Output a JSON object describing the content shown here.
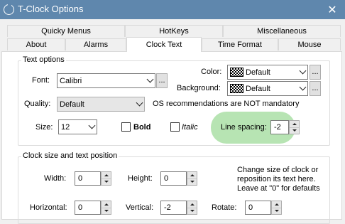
{
  "window": {
    "title": "T-Clock Options",
    "close_glyph": "✕",
    "accent": "#5f87ad"
  },
  "tabs_row1": [
    "Quicky Menus",
    "HotKeys",
    "Miscellaneous"
  ],
  "tabs_row2": [
    "About",
    "Alarms",
    "Clock Text",
    "Time Format",
    "Mouse"
  ],
  "selected_tab": "Clock Text",
  "text_options": {
    "group_label": "Text options",
    "font_label": "Font:",
    "font_value": "Calibri",
    "color_label": "Color:",
    "color_value": "Default",
    "background_label": "Background:",
    "background_value": "Default",
    "quality_label": "Quality:",
    "quality_value": "Default",
    "os_note": "OS recommendations are NOT mandatory",
    "size_label": "Size:",
    "size_value": "12",
    "bold_label": "Bold",
    "italic_label": "Italic",
    "line_spacing_label": "Line spacing:",
    "line_spacing_value": "-2",
    "ellipsis": "...",
    "highlight_color": "#b7e4b3"
  },
  "clock_size": {
    "group_label": "Clock size and text position",
    "width_label": "Width:",
    "width_value": "0",
    "height_label": "Height:",
    "height_value": "0",
    "help_line1": "Change size of clock or",
    "help_line2": "reposition its text here.",
    "help_line3": "Leave at \"0\" for defaults",
    "horizontal_label": "Horizontal:",
    "horizontal_value": "0",
    "vertical_label": "Vertical:",
    "vertical_value": "-2",
    "rotate_label": "Rotate:",
    "rotate_value": "0"
  }
}
